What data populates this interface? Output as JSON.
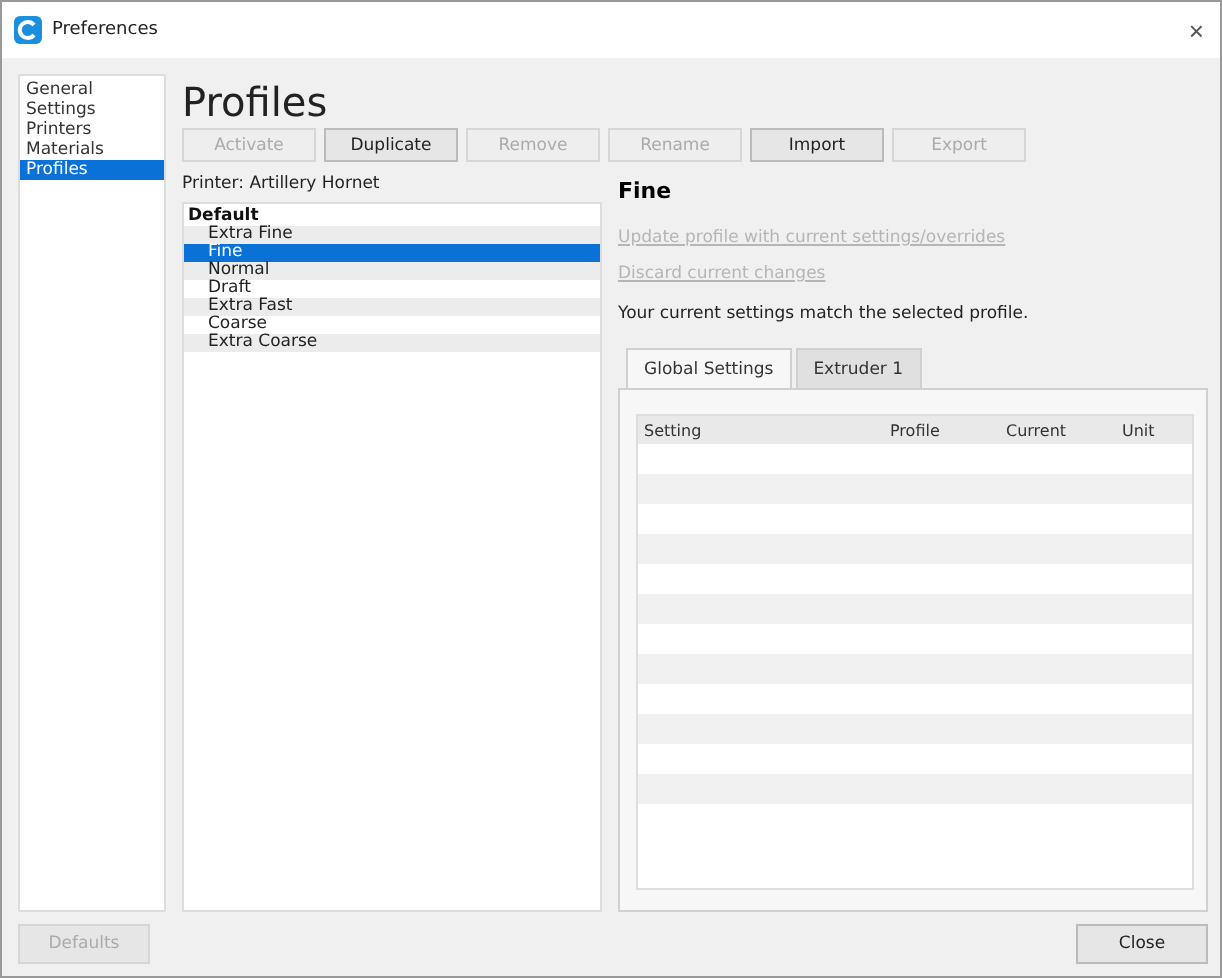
{
  "window": {
    "title": "Preferences",
    "close": "×"
  },
  "sidebar": {
    "items": [
      {
        "label": "General",
        "selected": false
      },
      {
        "label": "Settings",
        "selected": false
      },
      {
        "label": "Printers",
        "selected": false
      },
      {
        "label": "Materials",
        "selected": false
      },
      {
        "label": "Profiles",
        "selected": true
      }
    ]
  },
  "heading": "Profiles",
  "toolbar": [
    {
      "label": "Activate",
      "disabled": true
    },
    {
      "label": "Duplicate",
      "disabled": false
    },
    {
      "label": "Remove",
      "disabled": true
    },
    {
      "label": "Rename",
      "disabled": true
    },
    {
      "label": "Import",
      "disabled": false
    },
    {
      "label": "Export",
      "disabled": true
    }
  ],
  "printer_label": "Printer: Artillery Hornet",
  "profiles": {
    "group": "Default",
    "items": [
      {
        "label": "Extra Fine",
        "selected": false
      },
      {
        "label": "Fine",
        "selected": true
      },
      {
        "label": "Normal",
        "selected": false
      },
      {
        "label": "Draft",
        "selected": false
      },
      {
        "label": "Extra Fast",
        "selected": false
      },
      {
        "label": "Coarse",
        "selected": false
      },
      {
        "label": "Extra Coarse",
        "selected": false
      }
    ]
  },
  "detail": {
    "title": "Fine",
    "actions": [
      {
        "label": "Update profile with current settings/overrides",
        "disabled": true
      },
      {
        "label": "Discard current changes",
        "disabled": true
      }
    ],
    "message": "Your current settings match the selected profile.",
    "tabs": [
      {
        "label": "Global Settings",
        "selected": true
      },
      {
        "label": "Extruder 1",
        "selected": false
      }
    ],
    "table": {
      "columns": [
        "Setting",
        "Profile",
        "Current",
        "Unit"
      ]
    }
  },
  "footer": {
    "defaults": {
      "label": "Defaults",
      "disabled": true
    },
    "close": {
      "label": "Close",
      "disabled": false
    }
  }
}
